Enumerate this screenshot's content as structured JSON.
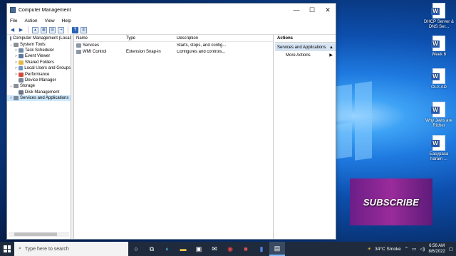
{
  "window": {
    "title": "Computer Management",
    "minimize": "—",
    "maximize": "☐",
    "close": "✕"
  },
  "menu": [
    "File",
    "Action",
    "View",
    "Help"
  ],
  "tree": [
    {
      "label": "Computer Management (Local",
      "indent": 0,
      "twisty": "",
      "icon": "computer-management-icon",
      "color": "#6b7f99"
    },
    {
      "label": "System Tools",
      "indent": 1,
      "twisty": "⌄",
      "icon": "tools-icon",
      "color": "#8a8f99"
    },
    {
      "label": "Task Scheduler",
      "indent": 2,
      "twisty": ">",
      "icon": "clock-icon",
      "color": "#6e88a8"
    },
    {
      "label": "Event Viewer",
      "indent": 2,
      "twisty": ">",
      "icon": "event-viewer-icon",
      "color": "#5f77a0"
    },
    {
      "label": "Shared Folders",
      "indent": 2,
      "twisty": ">",
      "icon": "folder-icon",
      "color": "#e2b84a"
    },
    {
      "label": "Local Users and Groups",
      "indent": 2,
      "twisty": ">",
      "icon": "users-icon",
      "color": "#6f93c9"
    },
    {
      "label": "Performance",
      "indent": 2,
      "twisty": ">",
      "icon": "performance-icon",
      "color": "#d24b3a"
    },
    {
      "label": "Device Manager",
      "indent": 2,
      "twisty": "",
      "icon": "device-icon",
      "color": "#7a8596"
    },
    {
      "label": "Storage",
      "indent": 1,
      "twisty": "⌄",
      "icon": "storage-icon",
      "color": "#8a8f99"
    },
    {
      "label": "Disk Management",
      "indent": 2,
      "twisty": "",
      "icon": "disk-icon",
      "color": "#6a7688"
    },
    {
      "label": "Services and Applications",
      "indent": 1,
      "twisty": ">",
      "icon": "services-icon",
      "color": "#7d8898"
    }
  ],
  "list": {
    "headers": [
      "Name",
      "Type",
      "Description"
    ],
    "rows": [
      {
        "name": "Services",
        "type": "",
        "description": "Starts, stops, and config..."
      },
      {
        "name": "WMI Control",
        "type": "Extension Snap-in",
        "description": "Configures and controls..."
      }
    ]
  },
  "actions": {
    "header": "Actions",
    "section": "Services and Applications",
    "items": [
      "More Actions"
    ]
  },
  "desktop_icons": [
    {
      "label": "DHCP Server & DNS  Ser...",
      "letter": "W"
    },
    {
      "label": "Week 6",
      "letter": "W"
    },
    {
      "label": "OLX AD",
      "letter": "W"
    },
    {
      "label": "Why Jews are Richer",
      "letter": "W"
    },
    {
      "label": "Easypasa haram ...",
      "letter": "W"
    }
  ],
  "promo": "SUBSCRIBE",
  "taskbar": {
    "search_placeholder": "Type here to search",
    "weather": "34°C  Smoke",
    "time": "6:56 AM",
    "date": "8/6/2022"
  },
  "colors": {
    "selection": "#cce8ff",
    "action_section": "#d5e3f3",
    "taskbar": "#1f2b3d"
  }
}
